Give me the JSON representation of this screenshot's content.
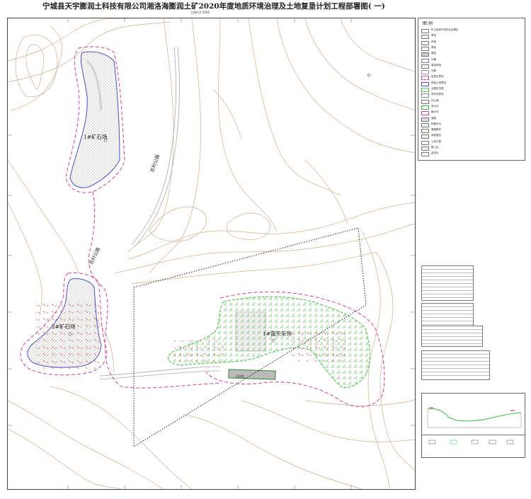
{
  "title": "宁城县天宇膨润土科技有限公司湘洛海膨润土矿2020年度地质环境治理及土地复垦计划工程部署图( 一)",
  "scale_text": "比例尺1:1000",
  "map_labels": {
    "dump1": "1#矿石场",
    "dump2": "2#矿石场",
    "pit1": "1#露天采场",
    "road1": "农村公路",
    "road2": "农村公路",
    "pond": "沉淀池"
  },
  "legend": {
    "title": "图  例",
    "items": [
      {
        "label": "矿山地质环境综合治理区"
      },
      {
        "label": "旱地"
      },
      {
        "label": "林地"
      },
      {
        "label": "草地"
      },
      {
        "label": "裸岩"
      },
      {
        "label": "坑塘"
      },
      {
        "label": "建设用地"
      },
      {
        "label": "沟渠"
      },
      {
        "label": "复垦区界线"
      },
      {
        "label": "损毁土地界线"
      },
      {
        "label": "治理区范围"
      },
      {
        "label": "采矿权界线"
      },
      {
        "label": "挡土墙"
      },
      {
        "label": "排水沟"
      },
      {
        "label": "截水沟"
      },
      {
        "label": "道路"
      },
      {
        "label": "种植乔木"
      },
      {
        "label": "撒播草籽"
      },
      {
        "label": "坡面整形"
      },
      {
        "label": "土地平整"
      },
      {
        "label": "覆土区"
      },
      {
        "label": "监测点"
      }
    ]
  },
  "colors": {
    "contour": "#c9a07a",
    "boundary_pink": "#e0379a",
    "boundary_blue": "#4b4bd0",
    "boundary_green": "#36c236",
    "frame": "#444444"
  }
}
